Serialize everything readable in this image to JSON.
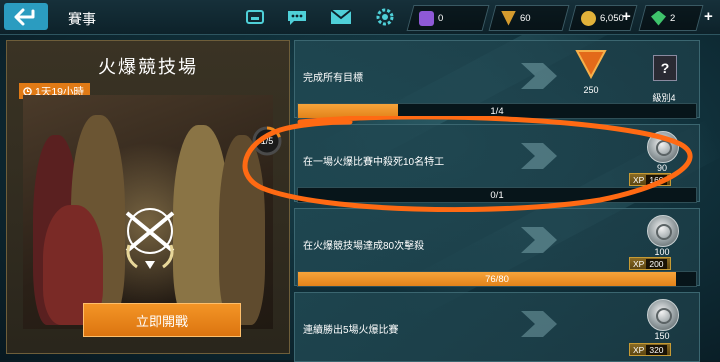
{
  "header": {
    "title": "賽事",
    "currencies": [
      {
        "icon": "tickets-icon",
        "value": "0",
        "color": "#8e59d6"
      },
      {
        "icon": "gold-chevron-icon",
        "value": "60",
        "color": "#d59b2e"
      },
      {
        "icon": "gold-coin-icon",
        "value": "6,050",
        "color": "#e2b23a"
      },
      {
        "icon": "gem-icon",
        "value": "2",
        "color": "#3fc46c"
      }
    ],
    "plus": "+"
  },
  "event": {
    "title": "火爆競技場",
    "timer": "1天19小時",
    "progress_label": "1/5",
    "progress_fraction": 0.2,
    "start_button": "立即開戰"
  },
  "objectives": [
    {
      "label": "完成所有目標",
      "progress_text": "1/4",
      "progress": 0.25,
      "reward_value": "250",
      "reward2_label": "級別4"
    },
    {
      "label": "在一場火爆比賽中殺死10名特工",
      "progress_text": "0/1",
      "progress": 0.0,
      "reward_value": "90",
      "xp_label": "XP",
      "xp_value": "160"
    },
    {
      "label": "在火爆競技場達成80次擊殺",
      "progress_text": "76/80",
      "progress": 0.95,
      "reward_value": "100",
      "xp_label": "XP",
      "xp_value": "200"
    },
    {
      "label": "連續勝出5場火爆比賽",
      "progress_text": "",
      "progress": 0.0,
      "reward_value": "150",
      "xp_label": "XP",
      "xp_value": "320"
    }
  ],
  "colors": {
    "accent": "#f08a1c",
    "annotation": "#ff6a13",
    "back_button": "#2b9cc0"
  }
}
